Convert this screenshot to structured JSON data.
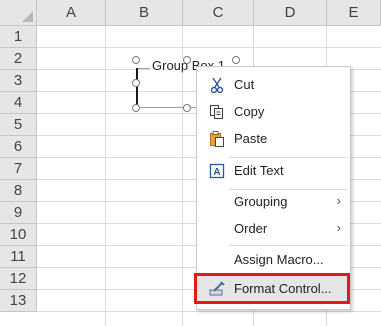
{
  "columns": [
    "A",
    "B",
    "C",
    "D",
    "E"
  ],
  "rows": [
    "1",
    "2",
    "3",
    "4",
    "5",
    "6",
    "7",
    "8",
    "9",
    "10",
    "11",
    "12",
    "13"
  ],
  "group_box": {
    "label": "Group Box 1"
  },
  "context_menu": {
    "cut": "Cut",
    "copy": "Copy",
    "paste": "Paste",
    "edit_text": "Edit Text",
    "grouping": "Grouping",
    "order": "Order",
    "assign_macro": "Assign Macro...",
    "format_control": "Format Control..."
  },
  "highlight_color": "#e01b1b"
}
